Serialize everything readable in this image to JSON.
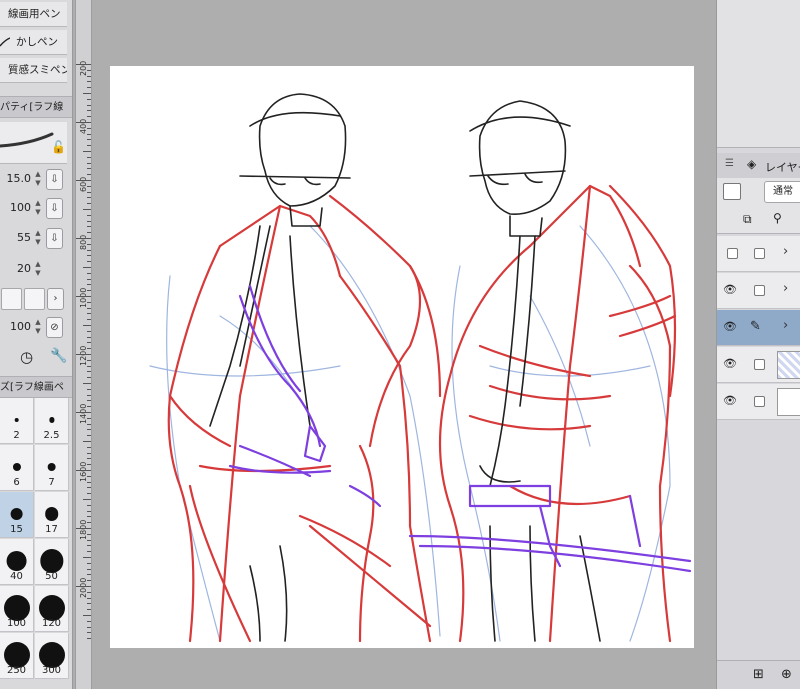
{
  "brushes": [
    {
      "label": "線画用ペン"
    },
    {
      "label": "かしペン"
    },
    {
      "label": "質感スミペン"
    }
  ],
  "tool_property": {
    "header": "パティ[ラフ線",
    "size": "15.0",
    "opacity": "100",
    "hardness": "55",
    "brush_density": "20",
    "stabilization": "100"
  },
  "brush_size_panel": {
    "header": "ズ[ラフ線画ペ",
    "sizes": [
      "2",
      "2.5",
      "6",
      "7",
      "15",
      "17",
      "40",
      "50",
      "100",
      "120",
      "250",
      "300"
    ],
    "selected": "15"
  },
  "ruler": {
    "labels": [
      "200",
      "400",
      "600",
      "800",
      "1000",
      "1200",
      "1400",
      "1600",
      "1800",
      "2000"
    ]
  },
  "layer_panel": {
    "tab_label": "レイヤー",
    "blend_mode": "通常",
    "layers": [
      {
        "visible": false,
        "type": "folder"
      },
      {
        "visible": true,
        "type": "folder"
      },
      {
        "visible": true,
        "type": "pen",
        "active": true
      },
      {
        "visible": true,
        "type": "pattern"
      },
      {
        "visible": true,
        "type": "paper"
      }
    ]
  },
  "colors": {
    "sketch_red": "#d73a3a",
    "sketch_purple": "#7d3fe0",
    "sketch_blue": "#9fb6e0",
    "line_black": "#222222",
    "active_layer": "#8fa9c9",
    "selected_size": "#bfd2e6"
  }
}
